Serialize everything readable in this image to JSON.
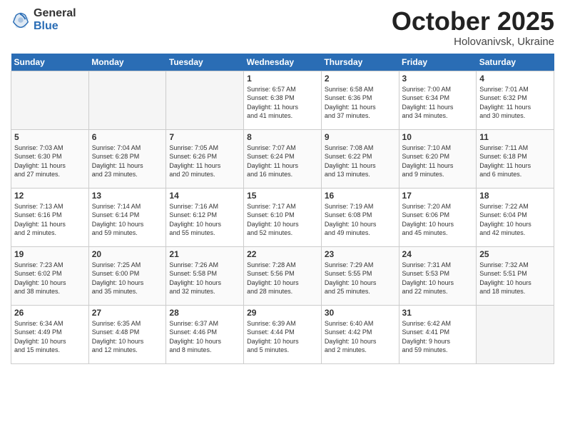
{
  "header": {
    "logo_general": "General",
    "logo_blue": "Blue",
    "month": "October 2025",
    "location": "Holovanivsk, Ukraine"
  },
  "weekdays": [
    "Sunday",
    "Monday",
    "Tuesday",
    "Wednesday",
    "Thursday",
    "Friday",
    "Saturday"
  ],
  "weeks": [
    [
      {
        "day": "",
        "info": "",
        "empty": true
      },
      {
        "day": "",
        "info": "",
        "empty": true
      },
      {
        "day": "",
        "info": "",
        "empty": true
      },
      {
        "day": "1",
        "info": "Sunrise: 6:57 AM\nSunset: 6:38 PM\nDaylight: 11 hours\nand 41 minutes.",
        "empty": false
      },
      {
        "day": "2",
        "info": "Sunrise: 6:58 AM\nSunset: 6:36 PM\nDaylight: 11 hours\nand 37 minutes.",
        "empty": false
      },
      {
        "day": "3",
        "info": "Sunrise: 7:00 AM\nSunset: 6:34 PM\nDaylight: 11 hours\nand 34 minutes.",
        "empty": false
      },
      {
        "day": "4",
        "info": "Sunrise: 7:01 AM\nSunset: 6:32 PM\nDaylight: 11 hours\nand 30 minutes.",
        "empty": false
      }
    ],
    [
      {
        "day": "5",
        "info": "Sunrise: 7:03 AM\nSunset: 6:30 PM\nDaylight: 11 hours\nand 27 minutes.",
        "empty": false
      },
      {
        "day": "6",
        "info": "Sunrise: 7:04 AM\nSunset: 6:28 PM\nDaylight: 11 hours\nand 23 minutes.",
        "empty": false
      },
      {
        "day": "7",
        "info": "Sunrise: 7:05 AM\nSunset: 6:26 PM\nDaylight: 11 hours\nand 20 minutes.",
        "empty": false
      },
      {
        "day": "8",
        "info": "Sunrise: 7:07 AM\nSunset: 6:24 PM\nDaylight: 11 hours\nand 16 minutes.",
        "empty": false
      },
      {
        "day": "9",
        "info": "Sunrise: 7:08 AM\nSunset: 6:22 PM\nDaylight: 11 hours\nand 13 minutes.",
        "empty": false
      },
      {
        "day": "10",
        "info": "Sunrise: 7:10 AM\nSunset: 6:20 PM\nDaylight: 11 hours\nand 9 minutes.",
        "empty": false
      },
      {
        "day": "11",
        "info": "Sunrise: 7:11 AM\nSunset: 6:18 PM\nDaylight: 11 hours\nand 6 minutes.",
        "empty": false
      }
    ],
    [
      {
        "day": "12",
        "info": "Sunrise: 7:13 AM\nSunset: 6:16 PM\nDaylight: 11 hours\nand 2 minutes.",
        "empty": false
      },
      {
        "day": "13",
        "info": "Sunrise: 7:14 AM\nSunset: 6:14 PM\nDaylight: 10 hours\nand 59 minutes.",
        "empty": false
      },
      {
        "day": "14",
        "info": "Sunrise: 7:16 AM\nSunset: 6:12 PM\nDaylight: 10 hours\nand 55 minutes.",
        "empty": false
      },
      {
        "day": "15",
        "info": "Sunrise: 7:17 AM\nSunset: 6:10 PM\nDaylight: 10 hours\nand 52 minutes.",
        "empty": false
      },
      {
        "day": "16",
        "info": "Sunrise: 7:19 AM\nSunset: 6:08 PM\nDaylight: 10 hours\nand 49 minutes.",
        "empty": false
      },
      {
        "day": "17",
        "info": "Sunrise: 7:20 AM\nSunset: 6:06 PM\nDaylight: 10 hours\nand 45 minutes.",
        "empty": false
      },
      {
        "day": "18",
        "info": "Sunrise: 7:22 AM\nSunset: 6:04 PM\nDaylight: 10 hours\nand 42 minutes.",
        "empty": false
      }
    ],
    [
      {
        "day": "19",
        "info": "Sunrise: 7:23 AM\nSunset: 6:02 PM\nDaylight: 10 hours\nand 38 minutes.",
        "empty": false
      },
      {
        "day": "20",
        "info": "Sunrise: 7:25 AM\nSunset: 6:00 PM\nDaylight: 10 hours\nand 35 minutes.",
        "empty": false
      },
      {
        "day": "21",
        "info": "Sunrise: 7:26 AM\nSunset: 5:58 PM\nDaylight: 10 hours\nand 32 minutes.",
        "empty": false
      },
      {
        "day": "22",
        "info": "Sunrise: 7:28 AM\nSunset: 5:56 PM\nDaylight: 10 hours\nand 28 minutes.",
        "empty": false
      },
      {
        "day": "23",
        "info": "Sunrise: 7:29 AM\nSunset: 5:55 PM\nDaylight: 10 hours\nand 25 minutes.",
        "empty": false
      },
      {
        "day": "24",
        "info": "Sunrise: 7:31 AM\nSunset: 5:53 PM\nDaylight: 10 hours\nand 22 minutes.",
        "empty": false
      },
      {
        "day": "25",
        "info": "Sunrise: 7:32 AM\nSunset: 5:51 PM\nDaylight: 10 hours\nand 18 minutes.",
        "empty": false
      }
    ],
    [
      {
        "day": "26",
        "info": "Sunrise: 6:34 AM\nSunset: 4:49 PM\nDaylight: 10 hours\nand 15 minutes.",
        "empty": false
      },
      {
        "day": "27",
        "info": "Sunrise: 6:35 AM\nSunset: 4:48 PM\nDaylight: 10 hours\nand 12 minutes.",
        "empty": false
      },
      {
        "day": "28",
        "info": "Sunrise: 6:37 AM\nSunset: 4:46 PM\nDaylight: 10 hours\nand 8 minutes.",
        "empty": false
      },
      {
        "day": "29",
        "info": "Sunrise: 6:39 AM\nSunset: 4:44 PM\nDaylight: 10 hours\nand 5 minutes.",
        "empty": false
      },
      {
        "day": "30",
        "info": "Sunrise: 6:40 AM\nSunset: 4:42 PM\nDaylight: 10 hours\nand 2 minutes.",
        "empty": false
      },
      {
        "day": "31",
        "info": "Sunrise: 6:42 AM\nSunset: 4:41 PM\nDaylight: 9 hours\nand 59 minutes.",
        "empty": false
      },
      {
        "day": "",
        "info": "",
        "empty": true
      }
    ]
  ]
}
